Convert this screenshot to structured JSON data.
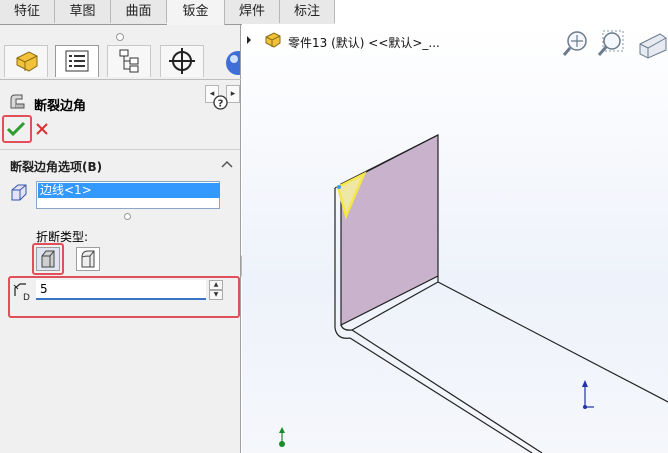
{
  "tabs": [
    {
      "label": "特征"
    },
    {
      "label": "草图"
    },
    {
      "label": "曲面"
    },
    {
      "label": "钣金",
      "active": true
    },
    {
      "label": "焊件"
    },
    {
      "label": "标注"
    }
  ],
  "property_manager": {
    "title": "断裂边角",
    "help_icon": "help-circle-icon",
    "ok_icon": "checkmark-icon",
    "cancel_icon": "x-icon",
    "group_title": "断裂边角选项(B)",
    "edge_selection": "边线<1>",
    "break_type_label": "折断类型:",
    "distance_value": "5",
    "distance_icon": "distance-d-icon"
  },
  "viewport": {
    "tree_label": "零件13 (默认) <<默认>_...",
    "face_color": "#c9b3cc",
    "highlight_color": "#f5e64a"
  },
  "colors": {
    "selection_blue": "#3399ff",
    "ok_green": "#2e9e2e",
    "cancel_red": "#d93030",
    "callout_red": "#e0505a"
  }
}
